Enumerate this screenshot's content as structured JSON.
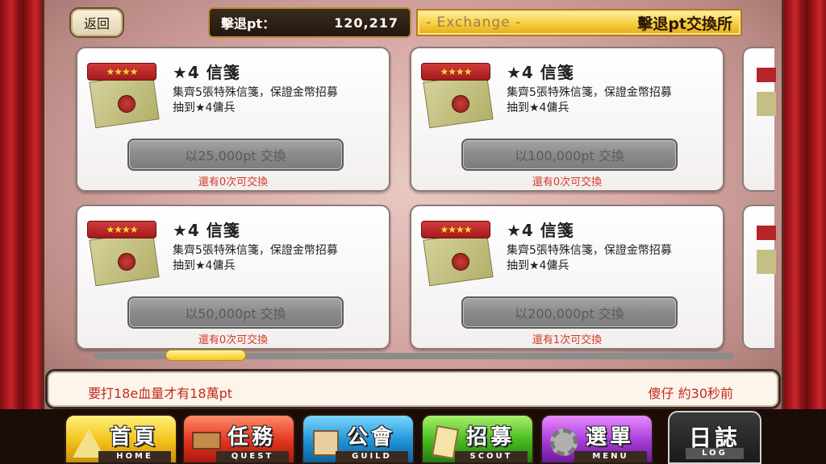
{
  "header": {
    "back_label": "返回",
    "points_label": "擊退pt：",
    "points_value": "120,217",
    "title_sub": "- Exchange -",
    "title_main": "擊退pt交換所"
  },
  "cards": [
    {
      "stars": "★★★★",
      "title": "★4 信箋",
      "desc_line1": "集齊5張特殊信箋，保證金幣招募",
      "desc_line2": "抽到★4傭兵",
      "button": "以25,000pt 交換",
      "remain": "還有0次可交換"
    },
    {
      "stars": "★★★★",
      "title": "★4 信箋",
      "desc_line1": "集齊5張特殊信箋，保證金幣招募",
      "desc_line2": "抽到★4傭兵",
      "button": "以100,000pt 交換",
      "remain": "還有0次可交換"
    },
    {
      "stars": "★★★★",
      "title": "★4 信箋",
      "desc_line1": "集齊5張特殊信箋，保證金幣招募",
      "desc_line2": "抽到★4傭兵",
      "button": "以50,000pt 交換",
      "remain": "還有0次可交換"
    },
    {
      "stars": "★★★★",
      "title": "★4 信箋",
      "desc_line1": "集齊5張特殊信箋，保證金幣招募",
      "desc_line2": "抽到★4傭兵",
      "button": "以200,000pt 交換",
      "remain": "還有1次可交換"
    }
  ],
  "chat": {
    "message": "要打18e血量才有18萬pt",
    "sender": "傻仔 約30秒前"
  },
  "nav": {
    "home": {
      "label": "首頁",
      "sub": "HOME"
    },
    "quest": {
      "label": "任務",
      "sub": "QUEST"
    },
    "guild": {
      "label": "公會",
      "sub": "GUILD"
    },
    "scout": {
      "label": "招募",
      "sub": "SCOUT"
    },
    "menu": {
      "label": "選單",
      "sub": "MENU"
    },
    "log": {
      "label": "日誌",
      "sub": "LOG"
    }
  },
  "colors": {
    "remain_text": "#d43a2a",
    "chat_text": "#c5281e",
    "title_banner": "#f5cf3e"
  }
}
